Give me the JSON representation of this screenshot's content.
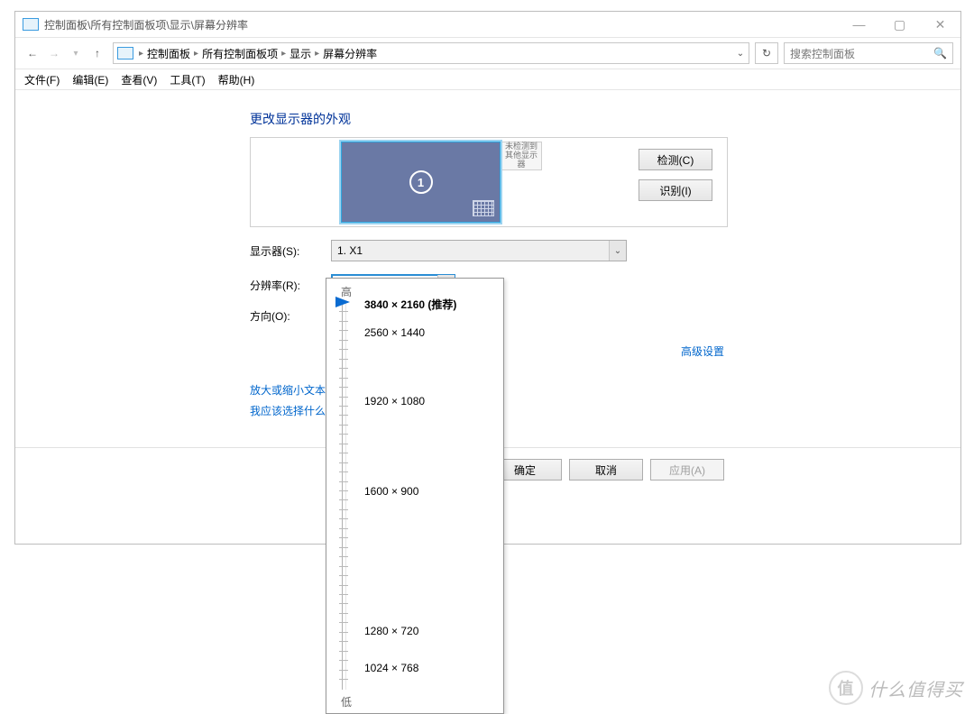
{
  "window": {
    "title": "控制面板\\所有控制面板项\\显示\\屏幕分辨率"
  },
  "breadcrumb": {
    "items": [
      "控制面板",
      "所有控制面板项",
      "显示",
      "屏幕分辨率"
    ]
  },
  "search": {
    "placeholder": "搜索控制面板"
  },
  "menu": {
    "file": "文件(F)",
    "edit": "编辑(E)",
    "view": "查看(V)",
    "tools": "工具(T)",
    "help": "帮助(H)"
  },
  "page": {
    "heading": "更改显示器的外观",
    "displayNumber": "1",
    "ghostText": "未检测到\n其他显示器",
    "detect": "检测(C)",
    "identify": "识别(I)",
    "labels": {
      "display": "显示器(S):",
      "resolution": "分辨率(R):",
      "orientation": "方向(O):"
    },
    "displaySelected": "1. X1",
    "resolutionSelected": "3840 × 2160 (推荐)",
    "advanced": "高级设置",
    "link1": "放大或缩小文本",
    "link2": "我应该选择什么",
    "ok": "确定",
    "cancel": "取消",
    "apply": "应用(A)"
  },
  "res_popup": {
    "top": "高",
    "bottom": "低",
    "items": [
      {
        "label": "3840 × 2160 (推荐)",
        "pos": 0,
        "selected": true
      },
      {
        "label": "2560 × 1440",
        "pos": 8,
        "selected": false
      },
      {
        "label": "1920 × 1080",
        "pos": 26,
        "selected": false
      },
      {
        "label": "1600 × 900",
        "pos": 50,
        "selected": false
      },
      {
        "label": "1280 × 720",
        "pos": 87,
        "selected": false
      },
      {
        "label": "1024 × 768",
        "pos": 97,
        "selected": false
      }
    ]
  },
  "watermark": {
    "text": "什么值得买",
    "badge": "值"
  }
}
